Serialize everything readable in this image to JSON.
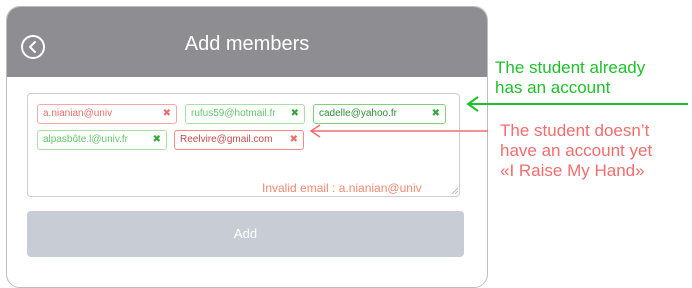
{
  "header": {
    "title": "Add members"
  },
  "chips": [
    {
      "email": "a.nianian@univ",
      "remove": "✖"
    },
    {
      "email": "rufus59@hotmail.fr",
      "remove": "✖"
    },
    {
      "email": "cadelle@yahoo.fr",
      "remove": "✖"
    },
    {
      "email": "alpasbôte.l@univ.fr",
      "remove": "✖"
    },
    {
      "email": "Reelvire@gmail.com",
      "remove": "✖"
    }
  ],
  "error_text": "Invalid email :  a.nianian@univ",
  "add_label": "Add",
  "annotations": {
    "existing_line1": "The student already",
    "existing_line2": "has an account",
    "missing_line1": "The student doesn’t",
    "missing_line2": "have an account yet",
    "missing_line3": "«I Raise My Hand»"
  },
  "colors": {
    "header": "#8e8e92",
    "valid": "#1fc02b",
    "invalid": "#f26d6d",
    "button": "#c8ccd4"
  }
}
